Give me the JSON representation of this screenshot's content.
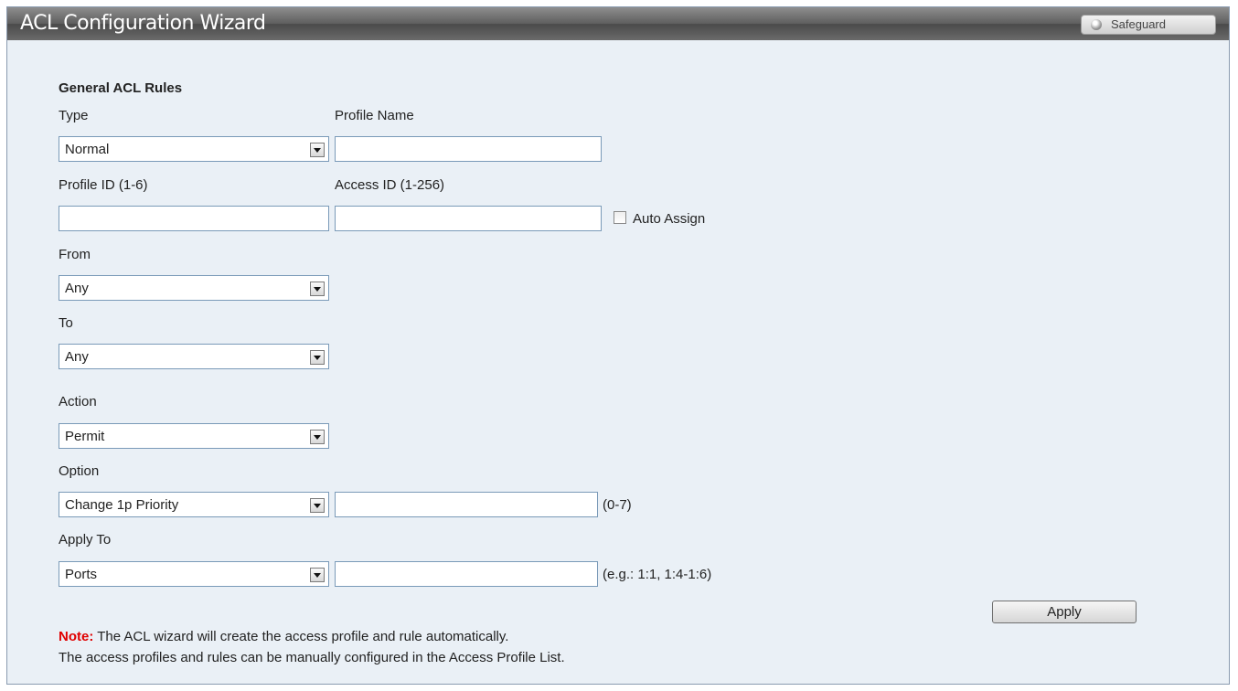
{
  "window": {
    "title": "ACL Configuration Wizard",
    "safeguard_label": "Safeguard"
  },
  "section": {
    "title": "General ACL Rules"
  },
  "fields": {
    "type": {
      "label": "Type",
      "value": "Normal"
    },
    "profile_name": {
      "label": "Profile Name",
      "value": ""
    },
    "profile_id": {
      "label": "Profile ID (1-6)",
      "value": ""
    },
    "access_id": {
      "label": "Access ID (1-256)",
      "value": ""
    },
    "auto_assign": {
      "label": "Auto Assign",
      "checked": false
    },
    "from": {
      "label": "From",
      "value": "Any"
    },
    "to": {
      "label": "To",
      "value": "Any"
    },
    "action": {
      "label": "Action",
      "value": "Permit"
    },
    "option": {
      "label": "Option",
      "value": "Change 1p Priority",
      "input_value": "",
      "hint": "(0-7)"
    },
    "apply_to": {
      "label": "Apply To",
      "value": "Ports",
      "input_value": "",
      "hint": "(e.g.: 1:1, 1:4-1:6)"
    }
  },
  "buttons": {
    "apply": "Apply"
  },
  "note": {
    "label": "Note:",
    "line1": "The ACL wizard will create the access profile and rule automatically.",
    "line2": "The access profiles and rules can be manually configured in the Access Profile List."
  },
  "colors": {
    "note_label": "#e00000",
    "titlebar": "#5e5e5e",
    "panel_bg": "#eaf0f6"
  }
}
